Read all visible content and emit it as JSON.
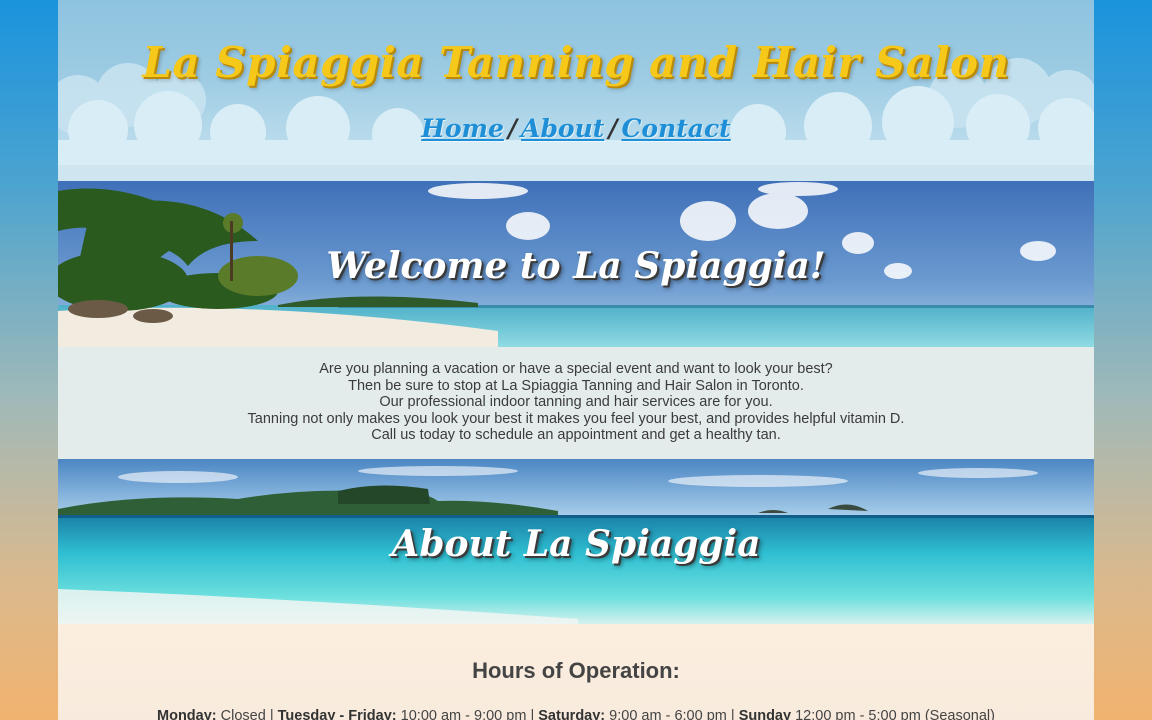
{
  "header": {
    "title": "La Spiaggia Tanning and Hair Salon",
    "nav": [
      {
        "label": "Home"
      },
      {
        "label": "About"
      },
      {
        "label": "Contact"
      }
    ],
    "separator": "/"
  },
  "welcome": {
    "title": "Welcome to La Spiaggia!",
    "lines": [
      "Are you planning a vacation or have a special event and want to look your best?",
      "Then be sure to stop at La Spiaggia Tanning and Hair Salon in Toronto.",
      "Our professional indoor tanning and hair services are for you.",
      "Tanning not only makes you look your best it makes you feel your best, and provides helpful vitamin D.",
      "Call us today to schedule an appointment and get a healthy tan."
    ]
  },
  "about": {
    "title": "About La Spiaggia"
  },
  "hours": {
    "heading": "Hours of Operation:",
    "days": [
      {
        "day": "Monday:",
        "time": "Closed"
      },
      {
        "day": "Tuesday - Friday:",
        "time": "10:00 am - 9:00 pm"
      },
      {
        "day": "Saturday:",
        "time": "9:00 am - 6:00 pm"
      },
      {
        "day": "Sunday",
        "time": "12:00 pm - 5:00 pm (Seasonal)"
      }
    ],
    "divider": "|"
  },
  "colors": {
    "title_yellow": "#f5c819",
    "nav_blue": "#1e8fd6",
    "sky_blue": "#8ec3df",
    "sea_turquoise": "#37c6d6"
  }
}
